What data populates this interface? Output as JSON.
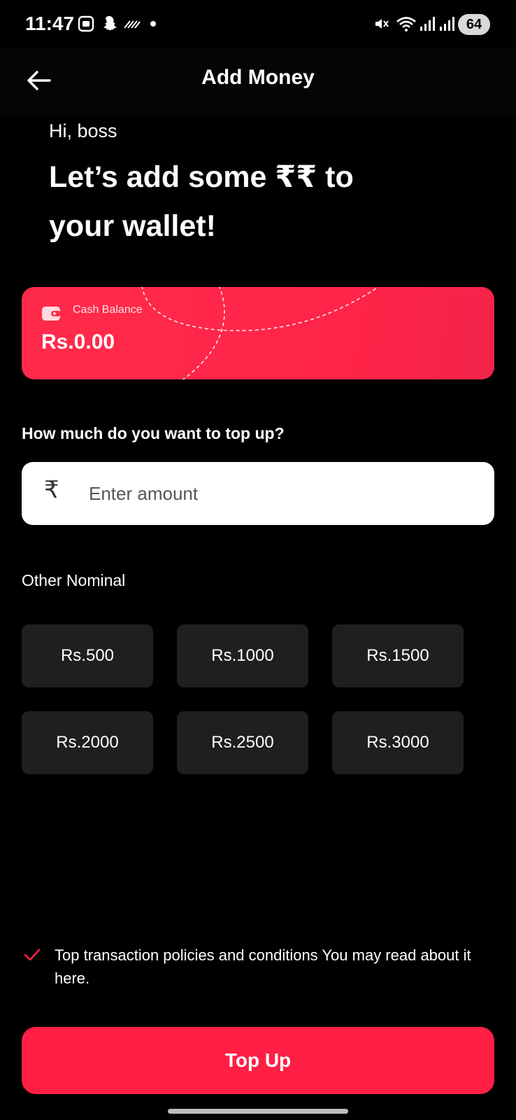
{
  "status_bar": {
    "time": "11:47",
    "battery": "64",
    "icons": [
      "screenshot-icon",
      "snapchat-icon",
      "signal-flag-icon",
      "dot-icon",
      "mute-icon",
      "wifi-icon",
      "signal-bars-icon",
      "signal-bars-icon"
    ]
  },
  "app_bar": {
    "title": "Add Money",
    "back_icon": "arrow-left-icon"
  },
  "greeting": "Hi, boss",
  "headline": "Let’s add some ₹₹ to your wallet!",
  "balance_card": {
    "label": "Cash Balance",
    "value": "Rs.0.00",
    "icon": "wallet-icon",
    "color": "#ff2448"
  },
  "topup_form": {
    "question": "How much do you want to top up?",
    "currency_symbol": "₹",
    "placeholder": "Enter amount",
    "value": ""
  },
  "nominal": {
    "label": "Other Nominal",
    "options": [
      "Rs.500",
      "Rs.1000",
      "Rs.1500",
      "Rs.2000",
      "Rs.2500",
      "Rs.3000"
    ]
  },
  "policy": {
    "text": "Top transaction policies and conditions You may read about it here.",
    "checked": true
  },
  "topup_button": {
    "label": "Top Up",
    "color": "#ff1f44"
  }
}
